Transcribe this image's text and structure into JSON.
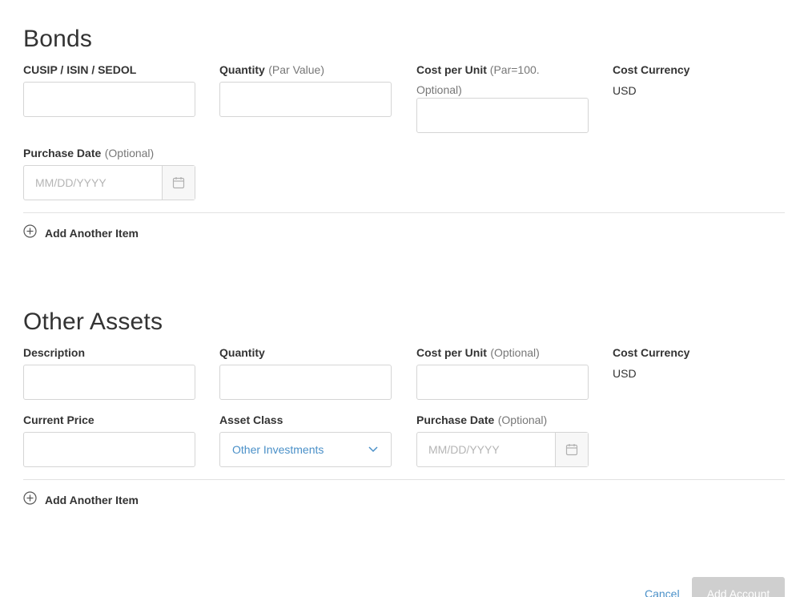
{
  "bonds": {
    "title": "Bonds",
    "cusip_label": "CUSIP / ISIN / SEDOL",
    "quantity_label": "Quantity",
    "quantity_hint": "(Par Value)",
    "cost_label": "Cost per Unit",
    "cost_hint_line1": "(Par=100.",
    "cost_hint_line2": "Optional)",
    "currency_label": "Cost Currency",
    "currency_value": "USD",
    "purchase_date_label": "Purchase Date",
    "purchase_date_hint": "(Optional)",
    "date_placeholder": "MM/DD/YYYY",
    "add_item_label": "Add Another Item"
  },
  "other_assets": {
    "title": "Other Assets",
    "description_label": "Description",
    "quantity_label": "Quantity",
    "cost_label": "Cost per Unit",
    "cost_hint": "(Optional)",
    "currency_label": "Cost Currency",
    "currency_value": "USD",
    "current_price_label": "Current Price",
    "asset_class_label": "Asset Class",
    "asset_class_value": "Other Investments",
    "purchase_date_label": "Purchase Date",
    "purchase_date_hint": "(Optional)",
    "date_placeholder": "MM/DD/YYYY",
    "add_item_label": "Add Another Item"
  },
  "footer": {
    "cancel_label": "Cancel",
    "add_account_label": "Add Account"
  },
  "icons": {
    "calendar": "calendar-icon",
    "add": "plus-circle-icon",
    "dropdown": "chevron-down-icon"
  },
  "colors": {
    "text": "#333333",
    "hint": "#777777",
    "link": "#4a90c8",
    "border": "#d5d5d5",
    "disabled_button": "#cfcfcf"
  }
}
